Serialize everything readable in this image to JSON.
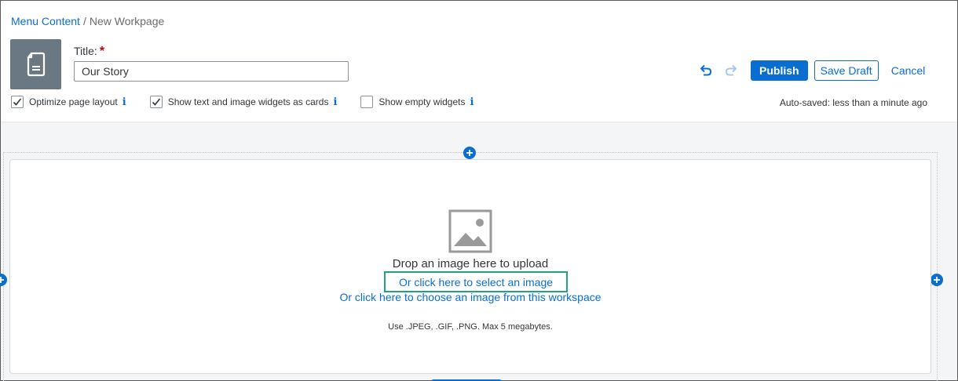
{
  "breadcrumb": {
    "parent": "Menu Content",
    "separator": "/",
    "current": "New Workpage"
  },
  "icons": {
    "page": "document-icon",
    "undo": "undo-icon",
    "redo": "redo-icon",
    "add": "plus-icon",
    "image": "image-placeholder-icon",
    "check": "checkmark-icon",
    "info": "info-icon"
  },
  "title_field": {
    "label": "Title:",
    "required_marker": "*",
    "value": "Our Story"
  },
  "toolbar": {
    "publish_label": "Publish",
    "save_draft_label": "Save Draft",
    "cancel_label": "Cancel"
  },
  "options": [
    {
      "label": "Optimize page layout",
      "checked": true,
      "info": "i"
    },
    {
      "label": "Show text and image widgets as cards",
      "checked": true,
      "info": "i"
    },
    {
      "label": "Show empty widgets",
      "checked": false,
      "info": "i"
    }
  ],
  "autosave": "Auto-saved: less than a minute ago",
  "image_widget": {
    "drop_text": "Drop an image here to upload",
    "select_link": "Or click here to select an image",
    "workspace_link": "Or click here to choose an image from this workspace",
    "hint": "Use .JPEG, .GIF, .PNG. Max 5 megabytes."
  },
  "colors": {
    "accent": "#0a6ed1",
    "highlight": "#20a283",
    "required": "#bb0000",
    "tile": "#6a7883"
  }
}
